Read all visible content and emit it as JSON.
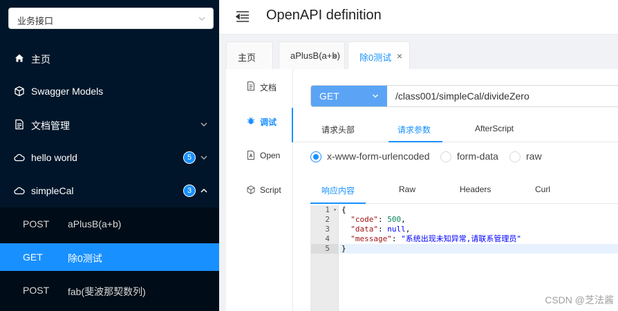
{
  "sidebar": {
    "group_select": "业务接口",
    "items": [
      {
        "label": "主页",
        "icon": "home-icon"
      },
      {
        "label": "Swagger Models",
        "icon": "cube-icon"
      },
      {
        "label": "文档管理",
        "icon": "document-icon"
      },
      {
        "label": "hello world",
        "icon": "cloud-icon",
        "badge": "5"
      },
      {
        "label": "simpleCal",
        "icon": "cloud-icon",
        "badge": "3"
      }
    ],
    "subitems": [
      {
        "method": "POST",
        "name": "aPlusB(a+b)"
      },
      {
        "method": "GET",
        "name": "除0测试"
      },
      {
        "method": "POST",
        "name": "fab(斐波那契数列)"
      }
    ]
  },
  "header": {
    "title": "OpenAPI definition"
  },
  "tabs": [
    {
      "label": "主页"
    },
    {
      "label": "aPlusB(a+b)",
      "close": "×"
    },
    {
      "label": "除0测试",
      "close": "×"
    }
  ],
  "vnav": [
    {
      "label": "文档",
      "icon": "file-icon"
    },
    {
      "label": "调试",
      "icon": "bug-icon"
    },
    {
      "label": "Open",
      "icon": "openapi-icon"
    },
    {
      "label": "Script",
      "icon": "script-icon"
    }
  ],
  "request": {
    "method": "GET",
    "url": "/class001/simpleCal/divideZero"
  },
  "subtabs": [
    "请求头部",
    "请求参数",
    "AfterScript"
  ],
  "content_types": [
    "x-www-form-urlencoded",
    "form-data",
    "raw"
  ],
  "response_tabs": [
    "响应内容",
    "Raw",
    "Headers",
    "Curl"
  ],
  "editor": {
    "line_numbers": [
      "1",
      "2",
      "3",
      "4",
      "5"
    ],
    "open": "{",
    "code_key": "\"code\"",
    "code_val": "500",
    "data_key": "\"data\"",
    "data_val": "null",
    "message_key": "\"message\"",
    "message_val": "\"系统出现未知异常,请联系管理员\"",
    "close": "}"
  },
  "watermark": "CSDN @芝法酱"
}
